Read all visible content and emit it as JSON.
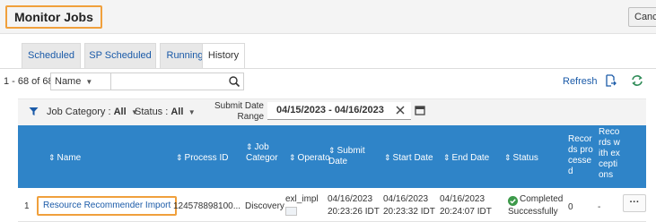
{
  "header": {
    "title": "Monitor Jobs",
    "cancel_label": "Cance"
  },
  "tabs": [
    {
      "label": "Scheduled"
    },
    {
      "label": "SP Scheduled"
    },
    {
      "label": "Running"
    },
    {
      "label": "History"
    }
  ],
  "active_tab": "History",
  "toolbar": {
    "count": "1 - 68 of 68",
    "search_field": "Name",
    "search_value": "",
    "refresh_label": "Refresh"
  },
  "filters": {
    "job_category_label": "Job Category :",
    "job_category_value": "All",
    "status_label": "Status :",
    "status_value": "All",
    "submit_date_label": "Submit Date Range",
    "submit_date_value": "04/15/2023 - 04/16/2023"
  },
  "table": {
    "columns": [
      "Name",
      "Process ID",
      "Job Categor",
      "Operato",
      "Submit Date",
      "Start Date",
      "End Date",
      "Status",
      "Records processed",
      "Records with exceptions"
    ],
    "rows": [
      {
        "index": "1",
        "name": "Resource Recommender Import",
        "process_id": "124578898100...",
        "job_category": "Discovery",
        "operator": "exl_impl",
        "submit_date": "04/16/2023",
        "submit_time": "20:23:26 IDT",
        "start_date": "04/16/2023",
        "start_time": "20:23:32 IDT",
        "end_date": "04/16/2023",
        "end_time": "20:24:07 IDT",
        "status_line1": "Completed",
        "status_line2": "Successfully",
        "records_processed": "0",
        "records_with_exceptions": "-"
      }
    ]
  },
  "colors": {
    "header_blue": "#2f84c8",
    "link_blue": "#1a5aa8",
    "highlight_orange": "#f0a03c",
    "success_green": "#3d9a4a"
  }
}
